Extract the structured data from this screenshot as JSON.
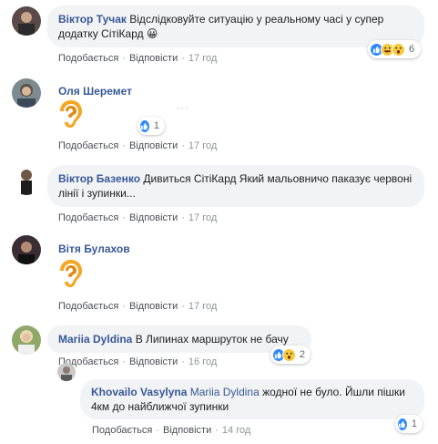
{
  "comments": [
    {
      "author": "Віктор Тучак",
      "text": "Відслідковуйте ситуацію у реальному часі у супер додатку СітіКард 😀",
      "like_label": "Подобається",
      "reply_label": "Відповісти",
      "time": "17 год",
      "reactions": {
        "icons": [
          "like-icon",
          "haha-icon",
          "wow-icon"
        ],
        "count": "6"
      }
    },
    {
      "author": "Оля Шеремет",
      "sticker": "ear-sticker",
      "like_label": "Подобається",
      "reply_label": "Відповісти",
      "time": "17 год",
      "reactions": {
        "icons": [
          "like-icon"
        ],
        "count": "1"
      }
    },
    {
      "author": "Віктор Базенко",
      "text": "Дивиться СітіКард Який мальовничо пaказує червоні лінії і зупинки...",
      "like_label": "Подобається",
      "reply_label": "Відповісти",
      "time": "17 год"
    },
    {
      "author": "Вітя Булахов",
      "sticker": "ear-sticker",
      "like_label": "Подобається",
      "reply_label": "Відповісти",
      "time": "17 год"
    },
    {
      "author": "Mariia Dyldina",
      "text": "В Липинах маршруток не бачу",
      "like_label": "Подобається",
      "reply_label": "Відповісти",
      "time": "16 год",
      "reactions": {
        "icons": [
          "like-icon",
          "wow-icon"
        ],
        "count": "2"
      }
    },
    {
      "author": "Khovailo Vasylyna",
      "mention": "Mariia Dyldina",
      "text": "жодної не було. Йшли пішки 4км до найближчої зупинки",
      "like_label": "Подобається",
      "reply_label": "Відповісти",
      "time": "14 год",
      "reactions": {
        "icons": [
          "like-icon"
        ],
        "count": "1"
      }
    }
  ],
  "colors": {
    "author": "#385898",
    "bubble": "#f2f3f5",
    "meta": "#90949c",
    "like": "#2d88ff",
    "emoji": "#f7c83a"
  }
}
